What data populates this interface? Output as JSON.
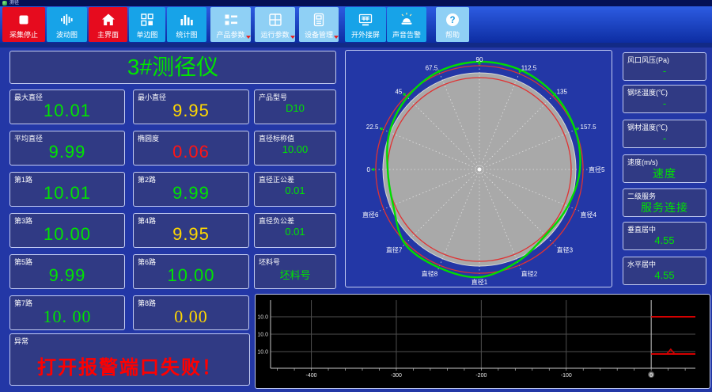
{
  "window": {
    "title": "测径"
  },
  "toolbar": {
    "buttons": [
      {
        "name": "stop-capture",
        "label": "采集停止",
        "icon": "stop-icon",
        "style": "red",
        "dropdown": false
      },
      {
        "name": "fluctuation-chart",
        "label": "波动图",
        "icon": "waveform-icon",
        "style": "cyan",
        "dropdown": false
      },
      {
        "name": "main-view",
        "label": "主界面",
        "icon": "home-icon",
        "style": "red",
        "dropdown": false
      },
      {
        "name": "single-edge-chart",
        "label": "单边图",
        "icon": "panels-icon",
        "style": "cyan",
        "dropdown": false
      },
      {
        "name": "statistics-chart",
        "label": "统计图",
        "icon": "barchart-icon",
        "style": "cyan",
        "dropdown": false
      },
      {
        "name": "product-params",
        "label": "产品参数",
        "icon": "grid-list-icon",
        "style": "light",
        "dropdown": true
      },
      {
        "name": "operation-params",
        "label": "运行参数",
        "icon": "window-grid-icon",
        "style": "light",
        "dropdown": true
      },
      {
        "name": "device-management",
        "label": "设备管理",
        "icon": "device-icon",
        "style": "light",
        "dropdown": true
      },
      {
        "name": "external-screen",
        "label": "开外接屏",
        "icon": "monitor-icon",
        "style": "cyan",
        "dropdown": false
      },
      {
        "name": "sound-alarm",
        "label": "声音告警",
        "icon": "siren-icon",
        "style": "cyan",
        "dropdown": false
      },
      {
        "name": "help",
        "label": "帮助",
        "icon": "help-icon",
        "style": "light",
        "dropdown": false
      }
    ]
  },
  "header": {
    "title": "3#测径仪"
  },
  "measurements": [
    {
      "label": "最大直径",
      "value": "10.01",
      "color": "green",
      "serif": false
    },
    {
      "label": "最小直径",
      "value": "9.95",
      "color": "yellow",
      "serif": false
    },
    {
      "label": "平均直径",
      "value": "9.99",
      "color": "green",
      "serif": false
    },
    {
      "label": "椭圆度",
      "value": "0.06",
      "color": "red",
      "serif": false
    },
    {
      "label": "第1路",
      "value": "10.01",
      "color": "green",
      "serif": false
    },
    {
      "label": "第2路",
      "value": "9.99",
      "color": "green",
      "serif": false
    },
    {
      "label": "第3路",
      "value": "10.00",
      "color": "green",
      "serif": false
    },
    {
      "label": "第4路",
      "value": "9.95",
      "color": "yellow",
      "serif": false
    },
    {
      "label": "第5路",
      "value": "9.99",
      "color": "green",
      "serif": false
    },
    {
      "label": "第6路",
      "value": "10.00",
      "color": "green",
      "serif": false
    },
    {
      "label": "第7路",
      "value": "10. 00",
      "color": "green",
      "serif": true
    },
    {
      "label": "第8路",
      "value": "0.00",
      "color": "yellow",
      "serif": true
    }
  ],
  "abnormal": {
    "label": "异常",
    "value": "打开报警端口失败！"
  },
  "product_info": [
    {
      "label": "产品型号",
      "value": "D10"
    },
    {
      "label": "直径标称值",
      "value": "10.00"
    },
    {
      "label": "直径正公差",
      "value": "0.01"
    },
    {
      "label": "直径负公差",
      "value": "0.01"
    },
    {
      "label": "坯料号",
      "value": "坯料号"
    }
  ],
  "status_panel": [
    {
      "label": "风口风压(Pa)",
      "value": "-"
    },
    {
      "label": "钢坯温度(℃)",
      "value": "-"
    },
    {
      "label": "钢材温度(℃)",
      "value": "-"
    },
    {
      "label": "速度(m/s)",
      "value": "速度"
    },
    {
      "label": "二级服务",
      "value": "服务连接"
    },
    {
      "label": "垂直居中",
      "value": "4.55"
    },
    {
      "label": "水平居中",
      "value": "4.55"
    }
  ],
  "chart_data": [
    {
      "type": "polar-profile",
      "description": "roundness-profile",
      "nominal_diameter": 10.0,
      "angle_tick_labels": [
        "0",
        "22.5",
        "45",
        "67.5",
        "90",
        "112.5",
        "135",
        "157.5"
      ],
      "diameter_labels": [
        "直径1",
        "直径2",
        "直径3",
        "直径4",
        "直径5",
        "直径6",
        "直径7",
        "直径8"
      ],
      "labels_placed": [
        {
          "text": "0",
          "deg": 180,
          "marker": true
        },
        {
          "text": "22.5",
          "deg": 157.5,
          "marker": true
        },
        {
          "text": "45",
          "deg": 135,
          "marker": true
        },
        {
          "text": "67.5",
          "deg": 112.5,
          "marker": true
        },
        {
          "text": "90",
          "deg": 90,
          "marker": true
        },
        {
          "text": "112.5",
          "deg": 67.5,
          "marker": true
        },
        {
          "text": "135",
          "deg": 45,
          "marker": true
        },
        {
          "text": "157.5",
          "deg": 22.5,
          "marker": true
        },
        {
          "text": "直径5",
          "deg": 0,
          "marker": false
        },
        {
          "text": "直径4",
          "deg": 337.5,
          "marker": false
        },
        {
          "text": "直径3",
          "deg": 315,
          "marker": false
        },
        {
          "text": "直径2",
          "deg": 292.5,
          "marker": false
        },
        {
          "text": "直径1",
          "deg": 270,
          "marker": false
        },
        {
          "text": "直径8",
          "deg": 247.5,
          "marker": false
        },
        {
          "text": "直径7",
          "deg": 225,
          "marker": false
        },
        {
          "text": "直径6",
          "deg": 202.5,
          "marker": false
        }
      ],
      "disc_radius": 122,
      "tolerance_radii": [
        116,
        131
      ],
      "spoke_count": 16,
      "profile_radii": [
        127,
        131,
        134,
        136,
        136,
        134,
        129,
        123,
        116,
        118,
        133,
        134,
        136,
        126,
        118,
        121
      ],
      "colors": {
        "disc": "#a9a9a9",
        "tolerance": "#e03232",
        "profile": "#00dd00",
        "spokes": "#e6e6e6"
      }
    },
    {
      "type": "line",
      "description": "diameter-trend",
      "plot_bg": "#000000",
      "y_tick_labels": [
        "10.0",
        "10.0",
        "10.0"
      ],
      "x_tick_labels": [
        "-400",
        "-300",
        "-200",
        "-100",
        "0"
      ],
      "x_range": [
        -448,
        52
      ],
      "series_color": "#d40000",
      "segments": [
        {
          "row": 0,
          "dy": 0,
          "x1": 0,
          "x2": 52
        },
        {
          "row": 2,
          "dy": 3,
          "x1": 0,
          "x2": 52,
          "spike": {
            "x": 23,
            "height": 6
          }
        }
      ]
    }
  ]
}
